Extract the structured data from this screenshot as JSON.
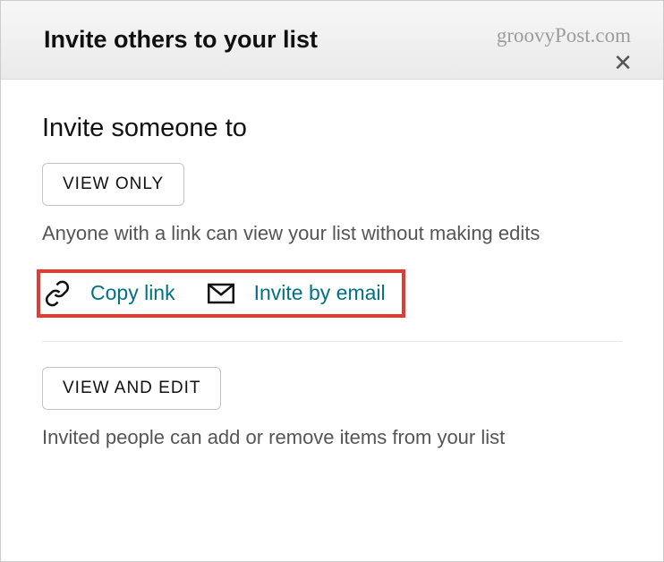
{
  "header": {
    "title": "Invite others to your list",
    "watermark": "groovyPost.com"
  },
  "content": {
    "section_title": "Invite someone to",
    "view_only": {
      "button_label": "VIEW ONLY",
      "description": "Anyone with a link can view your list without making edits",
      "actions": {
        "copy_link": "Copy link",
        "invite_email": "Invite by email"
      }
    },
    "view_edit": {
      "button_label": "VIEW AND EDIT",
      "description": "Invited people can add or remove items from your list"
    }
  }
}
